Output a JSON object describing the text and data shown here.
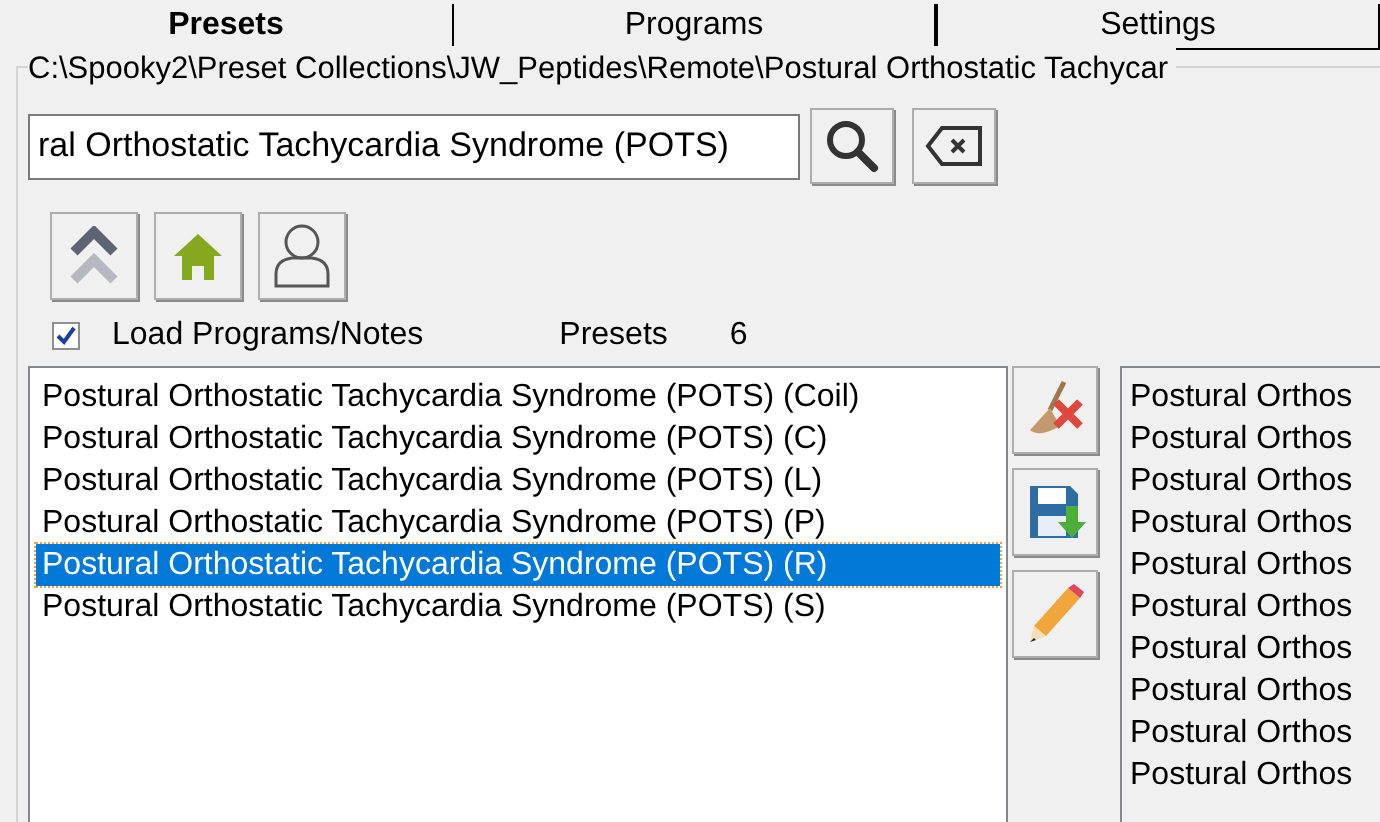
{
  "tabs": [
    {
      "label": "Presets",
      "selected": true
    },
    {
      "label": "Programs",
      "selected": false
    },
    {
      "label": "Settings",
      "selected": false
    }
  ],
  "path": "C:\\Spooky2\\Preset Collections\\JW_Peptides\\Remote\\Postural Orthostatic Tachycar",
  "search": {
    "value": "ral Orthostatic Tachycardia Syndrome (POTS)"
  },
  "load_programs": {
    "label": "Load Programs/Notes",
    "checked": true
  },
  "presets_label": "Presets",
  "presets_count": "6",
  "presets": [
    {
      "label": "Postural Orthostatic Tachycardia Syndrome (POTS) (Coil)",
      "selected": false
    },
    {
      "label": "Postural Orthostatic Tachycardia Syndrome (POTS) (C)",
      "selected": false
    },
    {
      "label": "Postural Orthostatic Tachycardia Syndrome (POTS) (L)",
      "selected": false
    },
    {
      "label": "Postural Orthostatic Tachycardia Syndrome (POTS) (P)",
      "selected": false
    },
    {
      "label": "Postural Orthostatic Tachycardia Syndrome (POTS) (R)",
      "selected": true
    },
    {
      "label": "Postural Orthostatic Tachycardia Syndrome (POTS) (S)",
      "selected": false
    }
  ],
  "programs": [
    "Postural Orthos",
    "Postural Orthos",
    "Postural Orthos",
    "Postural Orthos",
    "Postural Orthos",
    "Postural Orthos",
    "Postural Orthos",
    "Postural Orthos",
    "Postural Orthos",
    "Postural Orthos"
  ]
}
